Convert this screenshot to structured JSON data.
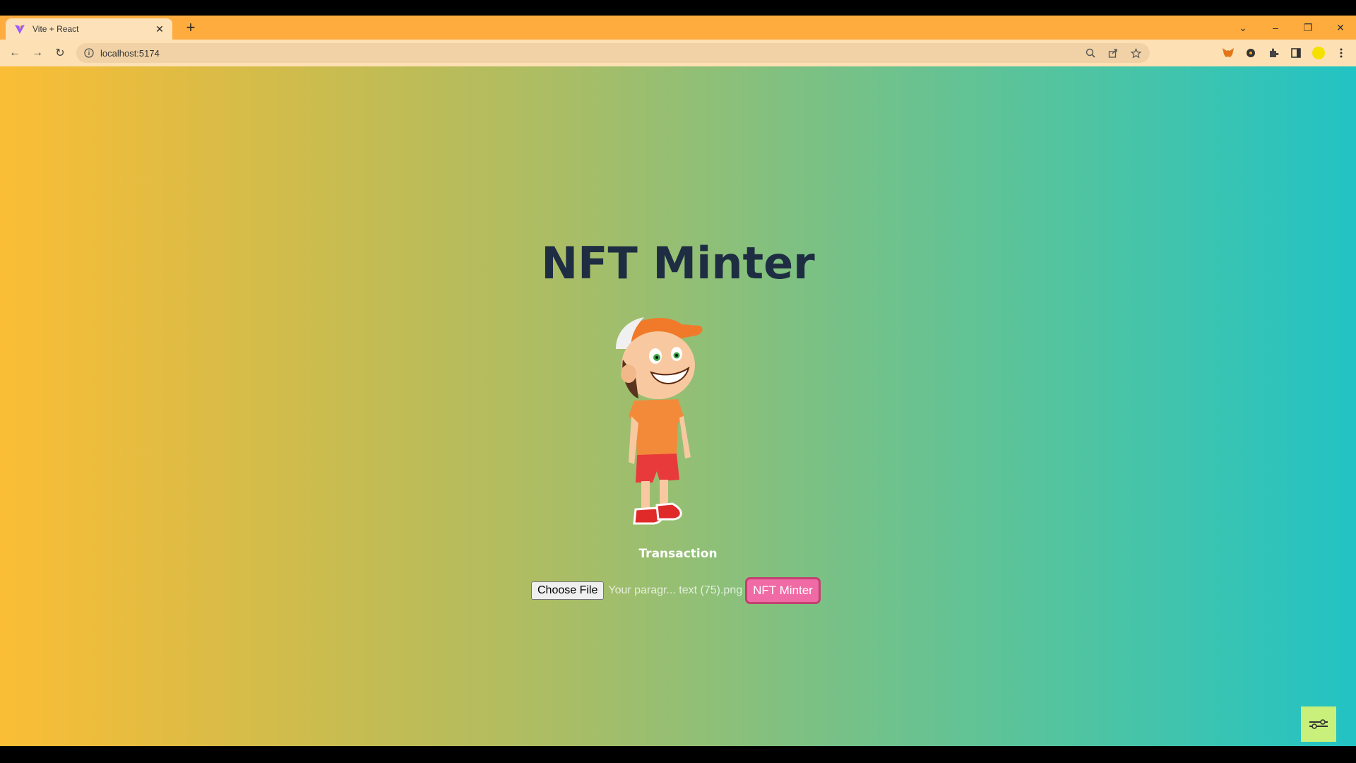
{
  "browser": {
    "tab": {
      "title": "Vite + React",
      "close_glyph": "✕"
    },
    "new_tab_glyph": "+",
    "controls": {
      "dropdown": "⌄",
      "minimize": "–",
      "restore": "❐",
      "close": "✕"
    },
    "nav": {
      "back": "←",
      "forward": "→",
      "reload": "↻"
    },
    "url": "localhost:5174"
  },
  "page": {
    "title": "NFT Minter",
    "image_caption": "Transaction",
    "file_input": {
      "button_label": "Choose File",
      "file_name": "Your paragr... text (75).png"
    },
    "mint_button_label": "NFT Minter"
  },
  "colors": {
    "gradient_start": "#fbbd35",
    "gradient_end": "#22c3c4",
    "title_color": "#1e2d42",
    "mint_button": "#f06aa5",
    "tabstrip": "#ffac3e"
  }
}
